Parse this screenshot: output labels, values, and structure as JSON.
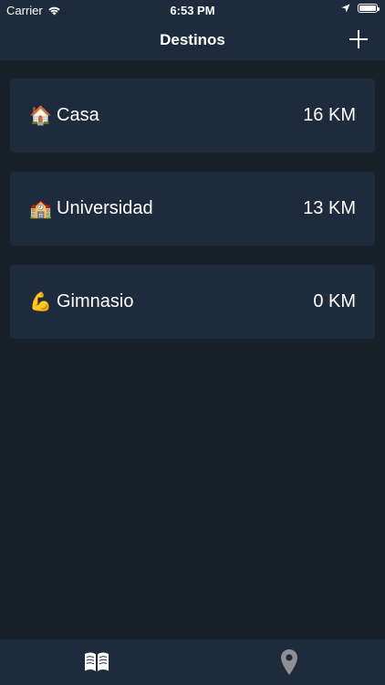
{
  "status_bar": {
    "carrier": "Carrier",
    "time": "6:53 PM",
    "battery_level": 1.0
  },
  "nav": {
    "title": "Destinos",
    "add_icon": "plus-icon"
  },
  "destinations": [
    {
      "emoji": "🏠",
      "name": "Casa",
      "distance": "16 KM"
    },
    {
      "emoji": "🏫",
      "name": "Universidad",
      "distance": "13 KM"
    },
    {
      "emoji": "💪",
      "name": "Gimnasio",
      "distance": "0 KM"
    }
  ],
  "tabs": [
    {
      "icon": "book-icon",
      "active": true,
      "color": "#ffffff"
    },
    {
      "icon": "map-pin-icon",
      "active": false,
      "color": "#8e8e93"
    }
  ],
  "colors": {
    "background": "#18202a",
    "bar": "#1d2b3c",
    "card": "#1d2b3c",
    "text": "#ffffff",
    "inactive": "#8e8e93"
  }
}
